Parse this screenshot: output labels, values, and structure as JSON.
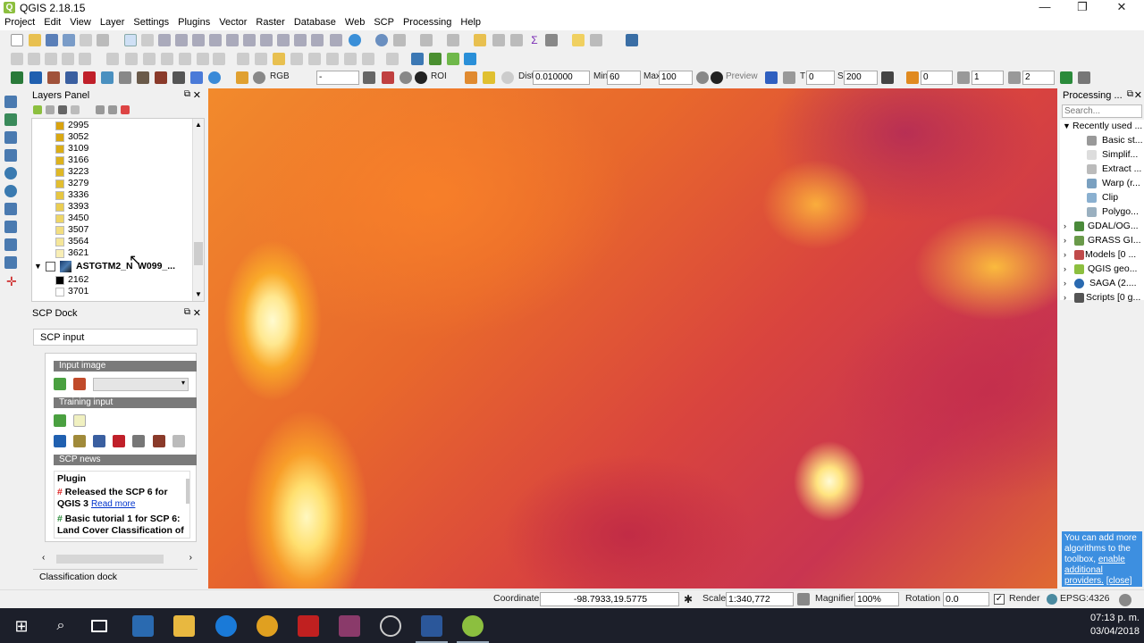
{
  "window": {
    "title": "QGIS 2.18.15",
    "min": "—",
    "restore": "❐",
    "close": "✕"
  },
  "menu": [
    "Project",
    "Edit",
    "View",
    "Layer",
    "Settings",
    "Plugins",
    "Vector",
    "Raster",
    "Database",
    "Web",
    "SCP",
    "Processing",
    "Help"
  ],
  "scp_toolbar": {
    "rgb_label": "RGB",
    "rgb_value": "-",
    "roi_label": "ROI",
    "dist_label": "Dist",
    "dist_value": "0.010000",
    "min_label": "Min",
    "min_value": "60",
    "max_label": "Max",
    "max_value": "100",
    "preview_label": "Preview",
    "t_label": "T",
    "t_value": "0",
    "s_label": "S",
    "s_value": "200",
    "spin1": "0",
    "spin2": "1",
    "spin3": "2"
  },
  "layers_panel": {
    "title": "Layers Panel",
    "items": [
      {
        "label": "2995",
        "color": "#d9a30f"
      },
      {
        "label": "3052",
        "color": "#d9a812"
      },
      {
        "label": "3109",
        "color": "#dbad17"
      },
      {
        "label": "3166",
        "color": "#ddb21d"
      },
      {
        "label": "3223",
        "color": "#dfb826"
      },
      {
        "label": "3279",
        "color": "#e2be30"
      },
      {
        "label": "3336",
        "color": "#e6c640"
      },
      {
        "label": "3393",
        "color": "#eacd52"
      },
      {
        "label": "3450",
        "color": "#eed566"
      },
      {
        "label": "3507",
        "color": "#f2de80"
      },
      {
        "label": "3564",
        "color": "#f5e699"
      },
      {
        "label": "3621",
        "color": "#f8eeb5"
      }
    ],
    "group_layer": "ASTGTM2_N",
    "group_layer_tail": "W099_...",
    "sub_items": [
      {
        "label": "2162",
        "color": "#000000"
      },
      {
        "label": "3701",
        "color": "#ffffff"
      }
    ]
  },
  "scp_dock": {
    "title": "SCP Dock",
    "tab": "SCP input",
    "input_image": "Input image",
    "training_input": "Training input",
    "scp_news": "SCP news",
    "news_heading": "Plugin",
    "news1": "Released the SCP 6 for QGIS 3",
    "news1_link": "Read more",
    "news2": "Basic tutorial 1 for SCP 6: Land Cover Classification of",
    "classification_dock": "Classification dock"
  },
  "processing": {
    "title": "Processing ...",
    "search_placeholder": "Search...",
    "recent": "Recently used ...",
    "recent_items": [
      "Basic st...",
      "Simplif...",
      "Extract ...",
      "Warp (r...",
      "Clip",
      "Polygo..."
    ],
    "providers": [
      "GDAL/OG...",
      "GRASS GI...",
      "Models [0 ...",
      "QGIS geo...",
      "SAGA (2....",
      "Scripts [0 g..."
    ],
    "note": "You can add more algorithms to the toolbox,",
    "note_link": "enable additional providers.",
    "note_close": "[close]"
  },
  "statusbar": {
    "coordinate_label": "Coordinate",
    "coordinate": "-98.7933,19.5775",
    "scale_label": "Scale",
    "scale": "1:340,772",
    "magnifier_label": "Magnifier",
    "magnifier": "100%",
    "rotation_label": "Rotation",
    "rotation": "0.0",
    "render_label": "Render",
    "crs": "EPSG:4326"
  },
  "taskbar": {
    "time": "07:13 p. m.",
    "date": "03/04/2018"
  }
}
